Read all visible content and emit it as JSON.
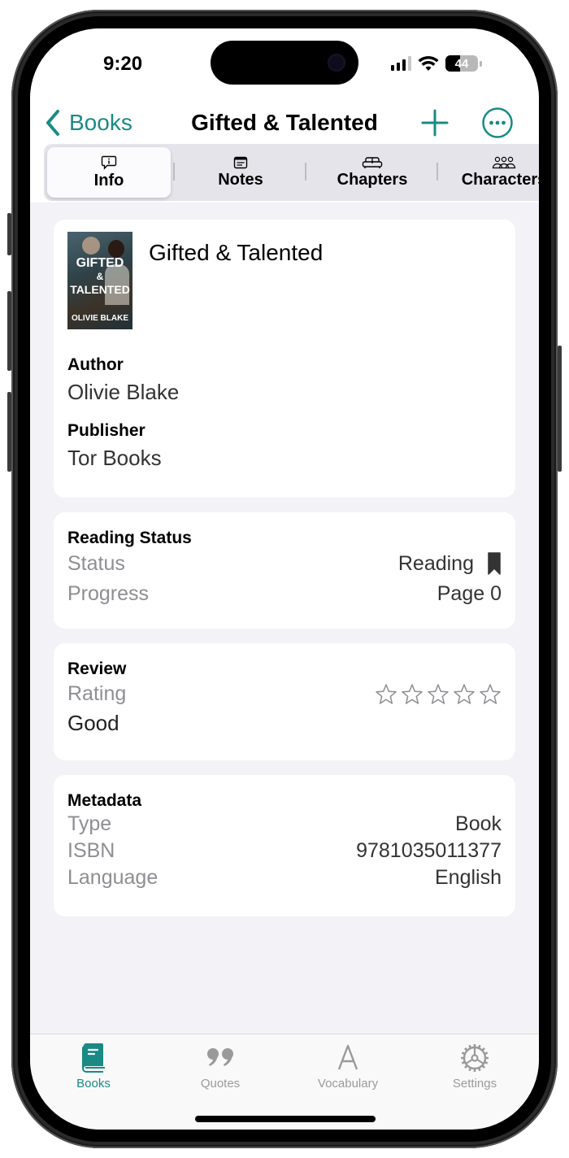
{
  "status_bar": {
    "time": "9:20",
    "battery": "44",
    "battery_level": 0.44
  },
  "nav": {
    "back_label": "Books",
    "title": "Gifted & Talented"
  },
  "segments": [
    {
      "label": "Info",
      "icon": "info-bubble-icon",
      "active": true
    },
    {
      "label": "Notes",
      "icon": "note-icon",
      "active": false
    },
    {
      "label": "Chapters",
      "icon": "sofa-icon",
      "active": false
    },
    {
      "label": "Characters",
      "icon": "people-icon",
      "active": false
    }
  ],
  "book": {
    "title": "Gifted & Talented",
    "cover": {
      "line1": "GIFTED",
      "line2": "&",
      "line3": "TALENTED",
      "author": "OLIVIE BLAKE"
    },
    "author_label": "Author",
    "author": "Olivie Blake",
    "publisher_label": "Publisher",
    "publisher": "Tor Books"
  },
  "reading_status": {
    "title": "Reading Status",
    "status_label": "Status",
    "status_value": "Reading",
    "status_icon": "bookmark-icon",
    "progress_label": "Progress",
    "progress_value": "Page 0"
  },
  "review": {
    "title": "Review",
    "rating_label": "Rating",
    "rating": 0,
    "rating_max": 5,
    "text": "Good"
  },
  "metadata": {
    "title": "Metadata",
    "rows": [
      {
        "label": "Type",
        "value": "Book"
      },
      {
        "label": "ISBN",
        "value": "9781035011377"
      },
      {
        "label": "Language",
        "value": "English"
      }
    ]
  },
  "tab_bar": [
    {
      "label": "Books",
      "icon": "book-icon",
      "active": true
    },
    {
      "label": "Quotes",
      "icon": "quote-icon",
      "active": false
    },
    {
      "label": "Vocabulary",
      "icon": "letter-a-icon",
      "active": false
    },
    {
      "label": "Settings",
      "icon": "gear-icon",
      "active": false
    }
  ],
  "colors": {
    "accent": "#1a8a85",
    "background": "#f2f2f7",
    "inactive": "#9a9a9a"
  }
}
